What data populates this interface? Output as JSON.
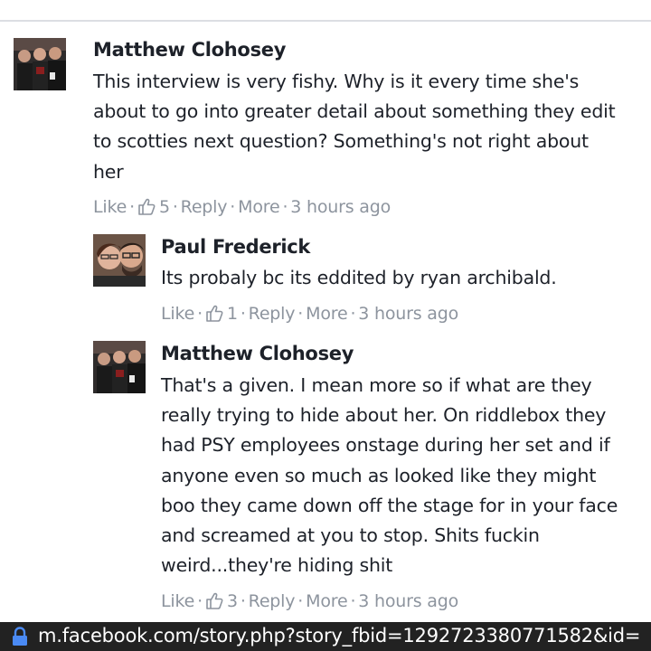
{
  "comments": [
    {
      "author": "Matthew Clohosey",
      "lines": [
        "This interview is very fishy. Why is it every time she's",
        "about to go into greater detail about something they edit",
        "to scotties next question? Something's not right about",
        "her"
      ],
      "actions": {
        "like": "Like",
        "likes": "5",
        "reply": "Reply",
        "more": "More",
        "time": "3 hours ago"
      }
    },
    {
      "author": "Paul Frederick",
      "lines": [
        "Its probaly bc its eddited by ryan archibald."
      ],
      "actions": {
        "like": "Like",
        "likes": "1",
        "reply": "Reply",
        "more": "More",
        "time": "3 hours ago"
      }
    },
    {
      "author": "Matthew Clohosey",
      "lines": [
        "That's a given. I mean more so if what are they",
        "really trying to hide about her. On riddlebox they",
        "had PSY employees onstage during her set and if",
        "anyone even so much as looked like they might",
        "boo they came down off the stage for in your face",
        "and screamed at you to stop. Shits fuckin",
        "weird...they're hiding shit"
      ],
      "actions": {
        "like": "Like",
        "likes": "3",
        "reply": "Reply",
        "more": "More",
        "time": "3 hours ago"
      }
    }
  ],
  "url_bar": {
    "url": "m.facebook.com/story.php?story_fbid=1292723380771582&id=",
    "icon": "lock-icon"
  },
  "colors": {
    "meta": "#8d949e",
    "text": "#1d2129",
    "url_bar_bg": "#222222",
    "lock": "#4a8af4"
  }
}
